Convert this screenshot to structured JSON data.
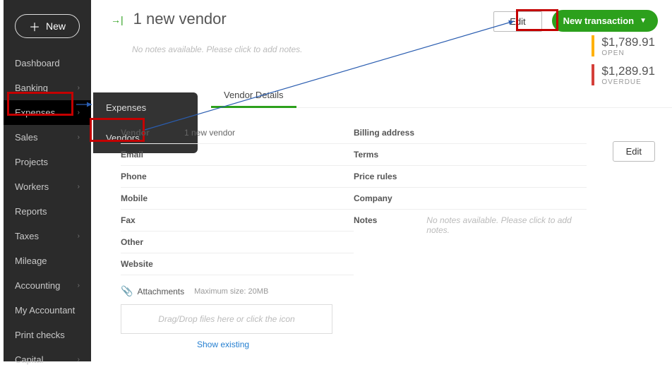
{
  "sidebar": {
    "new_label": "New",
    "items": [
      {
        "label": "Dashboard",
        "chev": false
      },
      {
        "label": "Banking",
        "chev": true
      },
      {
        "label": "Expenses",
        "chev": true,
        "highlighted": true
      },
      {
        "label": "Sales",
        "chev": true
      },
      {
        "label": "Projects",
        "chev": false
      },
      {
        "label": "Workers",
        "chev": true
      },
      {
        "label": "Reports",
        "chev": false
      },
      {
        "label": "Taxes",
        "chev": true
      },
      {
        "label": "Mileage",
        "chev": false
      },
      {
        "label": "Accounting",
        "chev": true
      },
      {
        "label": "My Accountant",
        "chev": false
      },
      {
        "label": "Print checks",
        "chev": false
      },
      {
        "label": "Capital",
        "chev": true
      }
    ]
  },
  "submenu": {
    "items": [
      {
        "label": "Expenses"
      },
      {
        "label": "Vendors"
      }
    ]
  },
  "header": {
    "title": "1 new vendor",
    "edit_label": "Edit",
    "new_transaction_label": "New transaction",
    "notes_placeholder": "No notes available. Please click to add notes."
  },
  "summary": {
    "open_amount": "$1,789.91",
    "open_label": "OPEN",
    "overdue_amount": "$1,289.91",
    "overdue_label": "OVERDUE"
  },
  "tabs": {
    "vendor_details": "Vendor Details"
  },
  "edit_right_label": "Edit",
  "details": {
    "left": [
      {
        "label": "Vendor",
        "value": "1 new vendor"
      },
      {
        "label": "Email",
        "value": ""
      },
      {
        "label": "Phone",
        "value": ""
      },
      {
        "label": "Mobile",
        "value": ""
      },
      {
        "label": "Fax",
        "value": ""
      },
      {
        "label": "Other",
        "value": ""
      },
      {
        "label": "Website",
        "value": ""
      }
    ],
    "right": [
      {
        "label": "Billing address",
        "value": ""
      },
      {
        "label": "Terms",
        "value": ""
      },
      {
        "label": "Price rules",
        "value": ""
      },
      {
        "label": "Company",
        "value": ""
      }
    ],
    "notes_label": "Notes",
    "notes_placeholder": "No notes available. Please click to add notes."
  },
  "attachments": {
    "label": "Attachments",
    "max_size": "Maximum size: 20MB",
    "dropzone_text": "Drag/Drop files here or click the icon",
    "show_existing": "Show existing"
  }
}
